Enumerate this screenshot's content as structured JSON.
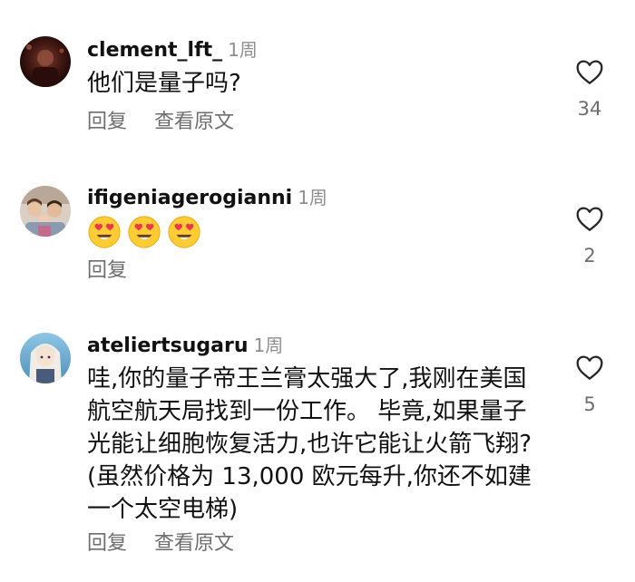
{
  "comments": [
    {
      "username": "clement_lft_",
      "time": "1周",
      "text": "他们是量子吗?",
      "reply_label": "回复",
      "translate_label": "查看原文",
      "likes": "34"
    },
    {
      "username": "ifigeniagerogianni",
      "time": "1周",
      "emojis": [
        "heart-eyes-emoji",
        "heart-eyes-emoji",
        "heart-eyes-emoji"
      ],
      "reply_label": "回复",
      "likes": "2"
    },
    {
      "username": "ateliertsugaru",
      "time": "1周",
      "text": "哇,你的量子帝王兰膏太强大了,我刚在美国航空航天局找到一份工作。 毕竟,如果量子光能让细胞恢复活力,也许它能让火箭飞翔? (虽然价格为 13,000 欧元每升,你还不如建一个太空电梯)",
      "reply_label": "回复",
      "translate_label": "查看原文",
      "likes": "5"
    }
  ],
  "colors": {
    "text": "#111111",
    "secondary": "#8e8e8e",
    "action": "#6e6e6e",
    "heart_outline": "#262626"
  }
}
